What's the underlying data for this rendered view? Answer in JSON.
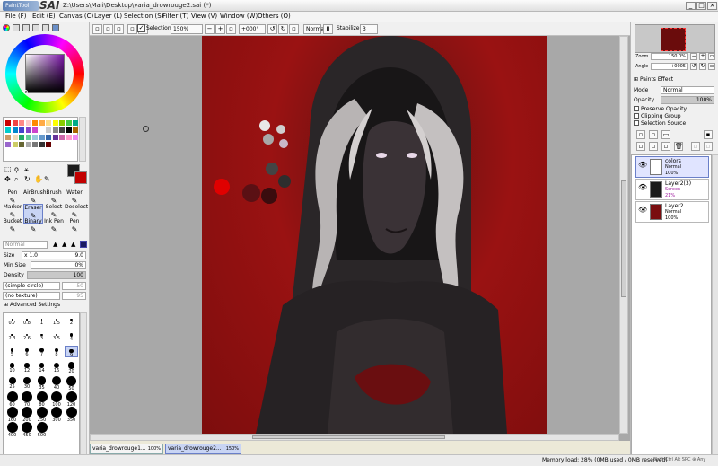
{
  "window": {
    "logo": "PaintTool",
    "app_name": "SAI",
    "title": "Z:\\Users\\Mali\\Desktop\\varia_drowrouge2.sai (*)",
    "minimize": "_",
    "maximize": "□",
    "close": "×"
  },
  "menu": [
    {
      "label": "File (F)"
    },
    {
      "label": "Edit (E)"
    },
    {
      "label": "Canvas (C)"
    },
    {
      "label": "Layer (L)"
    },
    {
      "label": "Selection (S)"
    },
    {
      "label": "Filter (T)"
    },
    {
      "label": "View (V)"
    },
    {
      "label": "Window (W)"
    },
    {
      "label": "Others (O)"
    }
  ],
  "toolbar": {
    "selection_label": "Selection",
    "selection_checked": true,
    "zoom": "150%",
    "angle": "+000°",
    "blend": "Normal",
    "stabilizer_label": "Stabilizer",
    "stabilizer_value": "3"
  },
  "tools": [
    {
      "label": "Pen"
    },
    {
      "label": "AirBrush"
    },
    {
      "label": "Brush"
    },
    {
      "label": "Water"
    },
    {
      "label": "Marker"
    },
    {
      "label": "Eraser"
    },
    {
      "label": "Select"
    },
    {
      "label": "Deselect"
    },
    {
      "label": "Bucket"
    },
    {
      "label": "Binary"
    },
    {
      "label": "Ink Pen"
    },
    {
      "label": "Pen"
    }
  ],
  "brush_settings": {
    "mode": "Normal",
    "size_label": "Size",
    "size_mult": "x 1.0",
    "size_value": "9.0",
    "min_size_label": "Min Size",
    "min_size_value": "0%",
    "density_label": "Density",
    "density_value": "100",
    "shape": "(simple circle)",
    "shape_value": "50",
    "texture": "(no texture)",
    "texture_value": "95",
    "advanced": "Advanced Settings"
  },
  "brush_sizes": [
    "0.7",
    "0.8",
    "1",
    "1.5",
    "2",
    "2.3",
    "2.6",
    "3",
    "3.5",
    "4",
    "5",
    "6",
    "7",
    "8",
    "9",
    "10",
    "12",
    "14",
    "16",
    "20",
    "25",
    "30",
    "35",
    "40",
    "50",
    "60",
    "70",
    "80",
    "100",
    "120",
    "160",
    "200",
    "250",
    "300",
    "350",
    "400",
    "450",
    "500"
  ],
  "navigator": {
    "zoom_label": "Zoom",
    "zoom_value": "150.0%",
    "angle_label": "Angle",
    "angle_value": "+0005"
  },
  "layer_settings": {
    "paints_effect": "Paints Effect",
    "mode_label": "Mode",
    "mode_value": "Normal",
    "opacity_label": "Opacity",
    "opacity_value": "100%",
    "preserve_opacity": "Preserve Opacity",
    "clipping_group": "Clipping Group",
    "selection_source": "Selection Source"
  },
  "layers": [
    {
      "name": "colors",
      "mode": "Normal",
      "opacity": "100%",
      "selected": true
    },
    {
      "name": "Layer2(3)",
      "mode": "Screen",
      "opacity": "21%",
      "selected": false
    },
    {
      "name": "Layer2",
      "mode": "Normal",
      "opacity": "100%",
      "selected": false
    }
  ],
  "documents": [
    {
      "name": "varia_drowrouge1...",
      "zoom": "100%",
      "active": false
    },
    {
      "name": "varia_drowrouge2...",
      "zoom": "150%",
      "active": true
    }
  ],
  "status": {
    "memory": "Memory load: 28% (0MB used / 0MB reserved)",
    "keys": "Shift Ctrl Alt SPC ⊕ Any"
  }
}
